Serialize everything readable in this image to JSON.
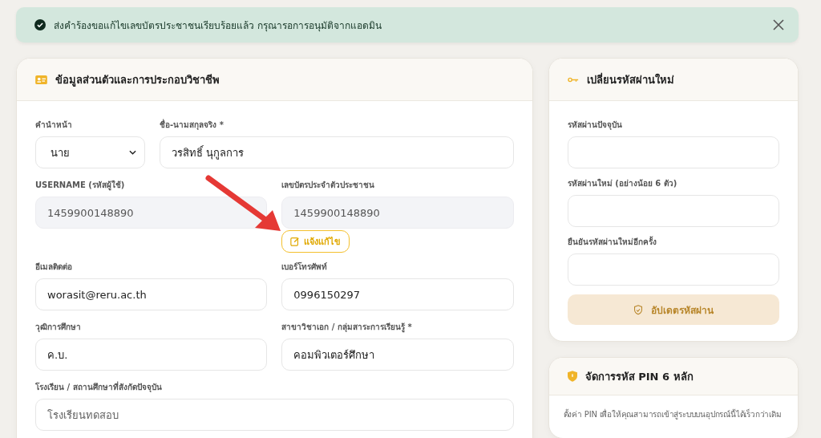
{
  "alert": {
    "message": "ส่งคำร้องขอแก้ไขเลขบัตรประชาชนเรียบร้อยแล้ว กรุณารอการอนุมัติจากแอดมิน"
  },
  "profile": {
    "title": "ข้อมูลส่วนตัวและการประกอบวิชาชีพ",
    "rows": [
      [
        {
          "kind": "select",
          "label": "คำนำหน้า",
          "value": "นาย",
          "disabled": false
        },
        {
          "kind": "input",
          "label": "ชื่อ-นามสกุลจริง *",
          "value": "วรสิทธิ์ นุกูลการ",
          "disabled": false
        }
      ],
      [
        {
          "kind": "input",
          "label": "USERNAME (รหัสผู้ใช้)",
          "value": "1459900148890",
          "disabled": true
        },
        {
          "kind": "input",
          "label": "เลขบัตรประจำตัวประชาชน",
          "value": "1459900148890",
          "disabled": true,
          "action": "แจ้งแก้ไข"
        }
      ],
      [
        {
          "kind": "input",
          "label": "อีเมลติดต่อ",
          "value": "worasit@reru.ac.th",
          "disabled": false
        },
        {
          "kind": "input",
          "label": "เบอร์โทรศัพท์",
          "value": "0996150297",
          "disabled": false
        }
      ],
      [
        {
          "kind": "input",
          "label": "วุฒิการศึกษา",
          "value": "ค.บ.",
          "disabled": false
        },
        {
          "kind": "input",
          "label": "สาขาวิชาเอก / กลุ่มสาระการเรียนรู้ *",
          "value": "คอมพิวเตอร์ศึกษา",
          "disabled": false
        }
      ],
      [
        {
          "kind": "input",
          "label": "โรงเรียน / สถานศึกษาที่สังกัดปัจจุบัน",
          "placeholder": "โรงเรียนทดสอบ",
          "disabled": false
        }
      ]
    ]
  },
  "password": {
    "title": "เปลี่ยนรหัสผ่านใหม่",
    "fields": [
      {
        "label": "รหัสผ่านปัจจุบัน"
      },
      {
        "label": "รหัสผ่านใหม่ (อย่างน้อย 6 ตัว)"
      },
      {
        "label": "ยืนยันรหัสผ่านใหม่อีกครั้ง"
      }
    ],
    "button": "อัปเดตรหัสผ่าน"
  },
  "pin": {
    "title": "จัดการรหัส PIN 6 หลัก",
    "description": "ตั้งค่า PIN เพื่อให้คุณสามารถเข้าสู่ระบบบนอุปกรณ์นี้ได้เร็วกว่าเดิม"
  }
}
